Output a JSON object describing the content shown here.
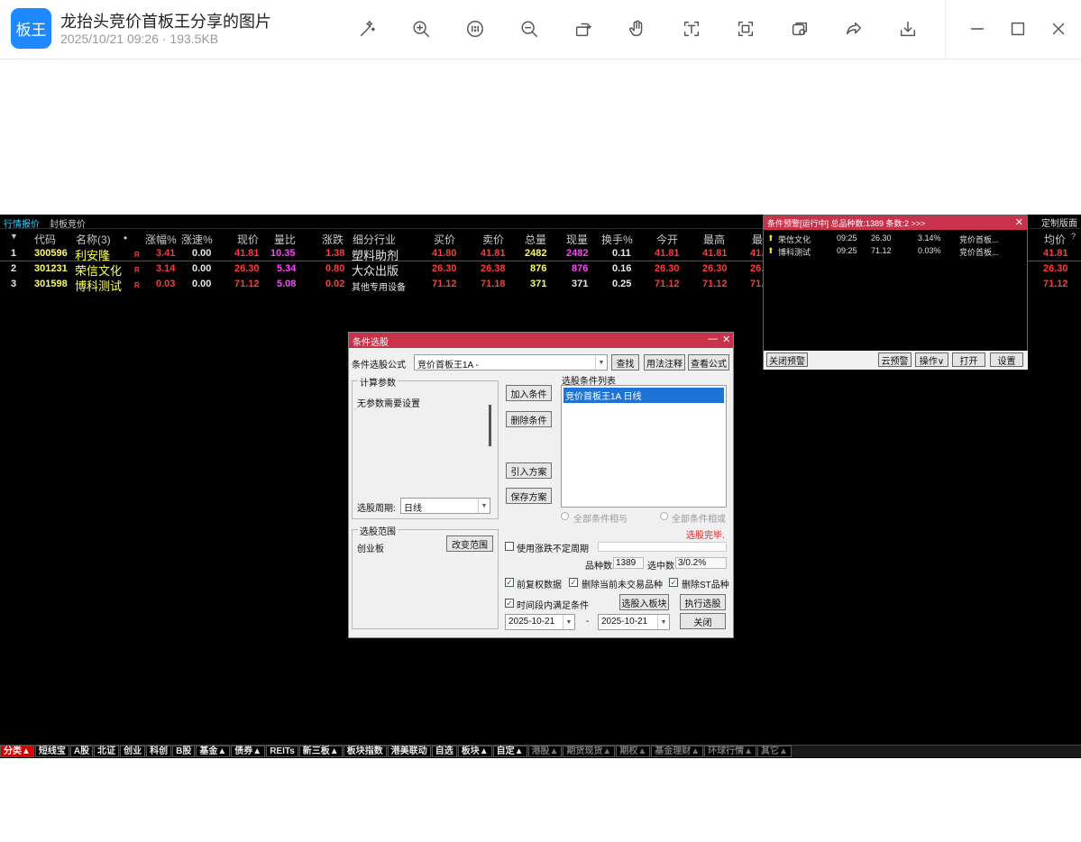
{
  "app": {
    "logo": "板王",
    "title": "龙抬头竞价首板王分享的图片",
    "meta": "2025/10/21 09:26 · 193.5KB"
  },
  "toolbar": [
    {
      "name": "ai-enhance",
      "icon": "magic-wand-icon"
    },
    {
      "name": "zoom-in",
      "icon": "zoom-in-icon"
    },
    {
      "name": "actual-size",
      "icon": "actual-size-icon"
    },
    {
      "name": "zoom-out",
      "icon": "zoom-out-icon"
    },
    {
      "name": "rotate",
      "icon": "rotate-icon"
    },
    {
      "name": "hand",
      "icon": "hand-icon"
    },
    {
      "name": "ocr",
      "icon": "text-recognize-icon"
    },
    {
      "name": "crop",
      "icon": "crop-icon"
    },
    {
      "name": "copy",
      "icon": "copy-icon"
    },
    {
      "name": "share",
      "icon": "share-icon"
    },
    {
      "name": "download",
      "icon": "download-icon"
    }
  ],
  "window_controls": {
    "min": "minimize-icon",
    "max": "maximize-icon",
    "close": "close-icon"
  },
  "screen": {
    "top_tabs": [
      "行情报价",
      "封板竞价"
    ],
    "top_right": [
      "定制版面"
    ],
    "headers": {
      "marker": "▼",
      "code": "代码",
      "name": "名称(3)",
      "dot": "•",
      "pct": "涨幅%",
      "speed": "涨速%",
      "price": "现价",
      "vol_ratio": "量比",
      "change": "涨跌",
      "industry": "细分行业",
      "bid": "买价",
      "ask": "卖价",
      "total_vol": "总量",
      "cur_vol": "现量",
      "turnover": "换手%",
      "open": "今开",
      "high": "最高",
      "low": "最",
      "avg": "均价",
      "avg_q": "?"
    },
    "rows": [
      {
        "idx": "1",
        "code": "300596",
        "name": "利安隆",
        "flag": "R",
        "pct": "3.41",
        "speed": "0.00",
        "price": "41.81",
        "vol_ratio": "10.35",
        "change": "1.38",
        "industry": "塑料助剂",
        "bid": "41.80",
        "ask": "41.81",
        "total_vol": "2482",
        "cur_vol": "2482",
        "turnover": "0.11",
        "open": "41.81",
        "high": "41.81",
        "low": "41.",
        "avg": "41.81"
      },
      {
        "idx": "2",
        "code": "301231",
        "name": "荣信文化",
        "flag": "R",
        "pct": "3.14",
        "speed": "0.00",
        "price": "26.30",
        "vol_ratio": "5.34",
        "change": "0.80",
        "industry": "大众出版",
        "bid": "26.30",
        "ask": "26.38",
        "total_vol": "876",
        "cur_vol": "876",
        "turnover": "0.16",
        "open": "26.30",
        "high": "26.30",
        "low": "26.",
        "avg": "26.30"
      },
      {
        "idx": "3",
        "code": "301598",
        "name": "博科测试",
        "flag": "R",
        "pct": "0.03",
        "speed": "0.00",
        "price": "71.12",
        "vol_ratio": "5.08",
        "change": "0.02",
        "industry": "其他专用设备",
        "bid": "71.12",
        "ask": "71.18",
        "total_vol": "371",
        "cur_vol": "371",
        "turnover": "0.25",
        "open": "71.12",
        "high": "71.12",
        "low": "71.",
        "avg": "71.12"
      }
    ],
    "alert": {
      "title": "条件预警[运行中] 总品种数:1389 条数:2  >>>",
      "rows": [
        {
          "name": "荣信文化",
          "time": "09:25",
          "price": "26.30",
          "pct": "3.14%",
          "note": "竞价首板..."
        },
        {
          "name": "博科测试",
          "time": "09:25",
          "price": "71.12",
          "pct": "0.03%",
          "note": "竞价首板..."
        }
      ],
      "buttons": {
        "close": "关闭预警",
        "cloud": "云预警",
        "ops": "操作∨",
        "open": "打开",
        "settings": "设置"
      }
    },
    "dialog": {
      "title": "条件选股",
      "formula_label": "条件选股公式",
      "formula_value": "竞价首板王1A  -",
      "btn_find": "查找",
      "btn_usage": "用法注释",
      "btn_view": "查看公式",
      "calc_group": "计算参数",
      "no_params": "无参数需要设置",
      "period_label": "选股周期:",
      "period_value": "日线",
      "btn_add": "加入条件",
      "btn_delete": "删除条件",
      "btn_import": "引入方案",
      "btn_save": "保存方案",
      "list_title": "选股条件列表",
      "list_item": "竞价首板王1A  日线",
      "radio_and": "全部条件相与",
      "radio_or": "全部条件相或",
      "status": "选股完毕.",
      "range_group": "选股范围",
      "range_value": "创业板",
      "btn_range": "改变范围",
      "chk_period": "使用涨跌不定周期",
      "count_label": "品种数",
      "count_value": "1389",
      "hit_label": "选中数",
      "hit_value": "3/0.2%",
      "chk_restore": "前复权数据",
      "chk_untraded": "删除当前未交易品种",
      "chk_st": "删除ST品种",
      "chk_time": "时间段内满足条件",
      "btn_to_block": "选股入板块",
      "btn_execute": "执行选股",
      "date_from": "2025-10-21",
      "date_dash": "-",
      "date_to": "2025-10-21",
      "btn_close": "关闭"
    },
    "bottom_tabs": [
      {
        "label": "分类▲",
        "state": "active"
      },
      {
        "label": "短线宝",
        "state": ""
      },
      {
        "label": "A股",
        "state": ""
      },
      {
        "label": "北证",
        "state": ""
      },
      {
        "label": "创业",
        "state": ""
      },
      {
        "label": "科创",
        "state": ""
      },
      {
        "label": "B股",
        "state": ""
      },
      {
        "label": "基金▲",
        "state": ""
      },
      {
        "label": "债券▲",
        "state": ""
      },
      {
        "label": "REITs",
        "state": ""
      },
      {
        "label": "新三板▲",
        "state": ""
      },
      {
        "label": "板块指数",
        "state": ""
      },
      {
        "label": "港美联动",
        "state": ""
      },
      {
        "label": "自选",
        "state": ""
      },
      {
        "label": "板块▲",
        "state": ""
      },
      {
        "label": "自定▲",
        "state": ""
      },
      {
        "label": "港股▲",
        "state": "dim"
      },
      {
        "label": "期货现货▲",
        "state": "dim"
      },
      {
        "label": "期权▲",
        "state": "dim"
      },
      {
        "label": "基金理财▲",
        "state": "dim"
      },
      {
        "label": "环球行情▲",
        "state": "dim"
      },
      {
        "label": "其它▲",
        "state": "dim"
      }
    ]
  }
}
